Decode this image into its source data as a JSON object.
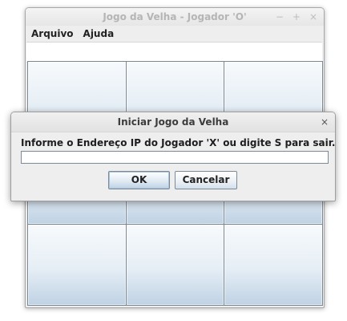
{
  "main_window": {
    "title": "Jogo da Velha - Jogador 'O'",
    "controls": {
      "minimize": "−",
      "maximize": "+",
      "close": "×"
    },
    "menu": [
      "Arquivo",
      "Ajuda"
    ],
    "status_text": "",
    "board": {
      "cells": [
        "",
        "",
        "",
        "",
        "",
        "",
        "",
        "",
        ""
      ]
    }
  },
  "dialog": {
    "title": "Iniciar Jogo da Velha",
    "close": "×",
    "message": "Informe o Endereço IP do Jogador 'X' ou digite S para sair.",
    "input_value": "",
    "ok_label": "OK",
    "cancel_label": "Cancelar"
  },
  "colors": {
    "cell_gradient_top": "#f7fafc",
    "cell_gradient_bottom": "#bfd2e4",
    "grid_line": "#7b8790",
    "window_bg": "#eeeeee"
  }
}
